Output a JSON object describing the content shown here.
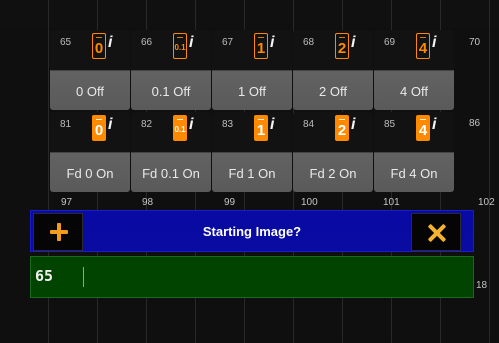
{
  "tiles_row_1": [
    {
      "num": "65",
      "value": "0",
      "label": "0 Off",
      "icon_style": "outline"
    },
    {
      "num": "66",
      "value": "0.1",
      "label": "0.1 Off",
      "icon_style": "outline"
    },
    {
      "num": "67",
      "value": "1",
      "label": "1 Off",
      "icon_style": "outline"
    },
    {
      "num": "68",
      "value": "2",
      "label": "2 Off",
      "icon_style": "outline"
    },
    {
      "num": "69",
      "value": "4",
      "label": "4 Off",
      "icon_style": "outline"
    }
  ],
  "tiles_row_2": [
    {
      "num": "81",
      "value": "0",
      "label": "Fd 0 On",
      "icon_style": "filled"
    },
    {
      "num": "82",
      "value": "0.1",
      "label": "Fd 0.1 On",
      "icon_style": "filled"
    },
    {
      "num": "83",
      "value": "1",
      "label": "Fd 1 On",
      "icon_style": "filled"
    },
    {
      "num": "84",
      "value": "2",
      "label": "Fd 2 On",
      "icon_style": "filled"
    },
    {
      "num": "85",
      "value": "4",
      "label": "Fd 4 On",
      "icon_style": "filled"
    }
  ],
  "edge_numbers": {
    "row1_right": "70",
    "row2_right": "86",
    "row3": [
      "97",
      "98",
      "99",
      "100",
      "101",
      "102"
    ],
    "input_right": "18"
  },
  "dialog": {
    "title": "Starting Image?",
    "input_value": "65"
  },
  "colors": {
    "accent": "#ff8a00",
    "dialog_title_bg": "#0a0ba0",
    "dialog_input_bg": "#004400",
    "background": "#0f0f0f"
  },
  "icons": {
    "add": "plus-icon",
    "close": "close-icon",
    "info": "info-icon",
    "preset": "fader-preset-icon"
  }
}
